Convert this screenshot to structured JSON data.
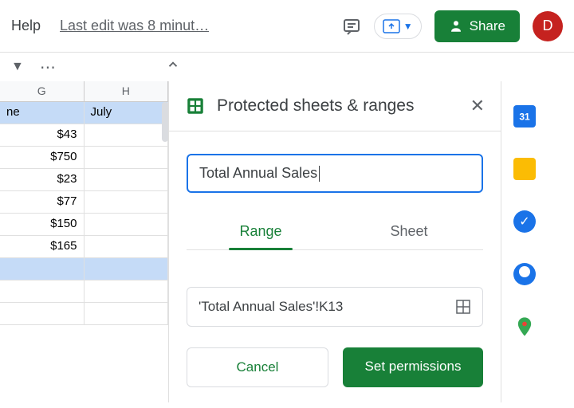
{
  "topbar": {
    "help": "Help",
    "edit_status": "Last edit was 8 minut…",
    "share_label": "Share",
    "avatar_initial": "D"
  },
  "sheet": {
    "columns": [
      "G",
      "H"
    ],
    "header_row": [
      "ne",
      "July"
    ],
    "rows": [
      [
        "$43",
        ""
      ],
      [
        "$750",
        ""
      ],
      [
        "$23",
        ""
      ],
      [
        "$77",
        ""
      ],
      [
        "$150",
        ""
      ],
      [
        "$165",
        ""
      ]
    ]
  },
  "panel": {
    "title": "Protected sheets & ranges",
    "description_value": "Total Annual Sales",
    "tabs": {
      "range": "Range",
      "sheet": "Sheet"
    },
    "range_value": "'Total Annual Sales'!K13",
    "cancel": "Cancel",
    "set_permissions": "Set permissions"
  }
}
